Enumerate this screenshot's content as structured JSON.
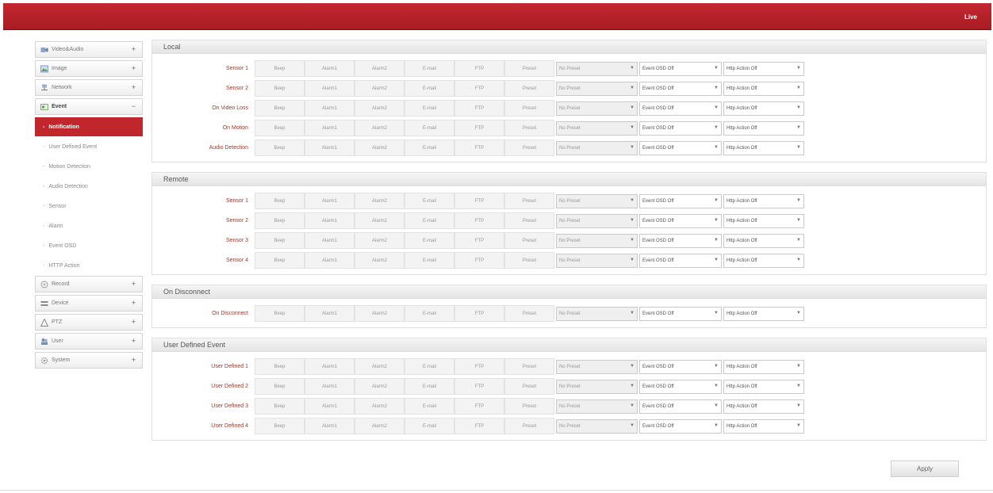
{
  "topbar": {
    "live_label": "Live"
  },
  "sidebar": {
    "items": [
      {
        "name": "menu-video-audio",
        "icon": "video-icon",
        "label": "Video&Audio",
        "toggle": "+"
      },
      {
        "name": "menu-image",
        "icon": "image-icon",
        "label": "Image",
        "toggle": "+"
      },
      {
        "name": "menu-network",
        "icon": "network-icon",
        "label": "Network",
        "toggle": "+"
      },
      {
        "name": "menu-event",
        "icon": "event-icon",
        "label": "Event",
        "toggle": "−",
        "open": true,
        "children": [
          {
            "label": "Notification",
            "active": true
          },
          {
            "label": "User Defined Event"
          },
          {
            "label": "Motion Detection"
          },
          {
            "label": "Audio Detection"
          },
          {
            "label": "Sensor"
          },
          {
            "label": "Alarm"
          },
          {
            "label": "Event OSD"
          },
          {
            "label": "HTTP Action"
          }
        ]
      },
      {
        "name": "menu-record",
        "icon": "record-icon",
        "label": "Record",
        "toggle": "+"
      },
      {
        "name": "menu-device",
        "icon": "device-icon",
        "label": "Device",
        "toggle": "+"
      },
      {
        "name": "menu-ptz",
        "icon": "ptz-icon",
        "label": "PTZ",
        "toggle": "+"
      },
      {
        "name": "menu-user",
        "icon": "user-icon",
        "label": "User",
        "toggle": "+"
      },
      {
        "name": "menu-system",
        "icon": "system-icon",
        "label": "System",
        "toggle": "+"
      }
    ]
  },
  "actions": [
    "Beep",
    "Alarm1",
    "Alarm2",
    "E-mail",
    "FTP",
    "Preset"
  ],
  "selects": {
    "preset": "No Preset",
    "osd": "Event OSD Off",
    "http": "Http Action Off"
  },
  "sections": [
    {
      "title": "Local",
      "rows": [
        "Sensor 1",
        "Sensor 2",
        "On Video Loss",
        "On Motion",
        "Audio Detection"
      ]
    },
    {
      "title": "Remote",
      "rows": [
        "Sensor 1",
        "Sensor 2",
        "Sensor 3",
        "Sensor 4"
      ]
    },
    {
      "title": "On Disconnect",
      "rows": [
        "On Disconnect"
      ]
    },
    {
      "title": "User Defined Event",
      "rows": [
        "User Defined 1",
        "User Defined 2",
        "User Defined 3",
        "User Defined 4"
      ]
    }
  ],
  "apply_label": "Apply",
  "colors": {
    "brand_red": "#c0262c",
    "label_red": "#a0392b"
  }
}
